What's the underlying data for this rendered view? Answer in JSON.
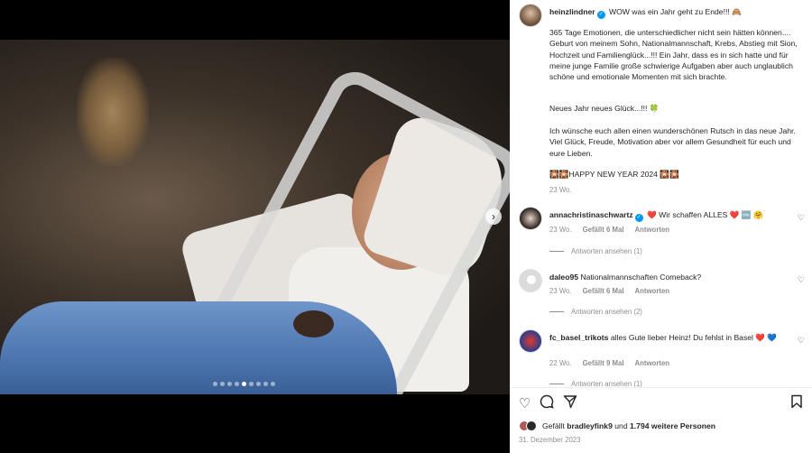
{
  "post": {
    "username": "heinzlindner",
    "headline": "WOW was ein Jahr geht zu Ende!!! 🙈",
    "paragraphs": [
      "365 Tage Emotionen, die unterschiedlicher nicht sein hätten können.... Geburt von meinem Sohn, Nationalmannschaft, Krebs, Abstieg mit Sion, Hochzeit und Familienglück...!!! Ein Jahr, dass es in sich hatte und für meine junge Familie große schwierige Aufgaben aber auch unglaublich schöne und emotionale Momenten mit sich brachte.",
      "Neues Jahr neues Glück...!!! 🍀",
      "Ich wünsche euch allen einen wunderschönen Rutsch in das neue Jahr. Viel Glück, Freude, Motivation aber vor allem Gesundheit für euch und eure Lieben.",
      "🎇🎇HAPPY NEW YEAR 2024 🎇🎇"
    ],
    "age": "23 Wo."
  },
  "comments": [
    {
      "username": "annachristinaschwartz",
      "text": "❤️ Wir schaffen ALLES ❤️ 🆒 🤗",
      "age": "23 Wo.",
      "likes": "Gefällt 6 Mal",
      "reply": "Antworten",
      "view_replies": "Antworten ansehen (1)"
    },
    {
      "username": "daleo95",
      "text": "Nationalmannschaften Comeback?",
      "age": "23 Wo.",
      "likes": "Gefällt 6 Mal",
      "reply": "Antworten",
      "view_replies": "Antworten ansehen (2)"
    },
    {
      "username": "fc_basel_trikots",
      "text": "alles Gute lieber Heinz! Du fehlst in Basel ❤️ 💙",
      "age": "22 Wo.",
      "likes": "Gefällt 9 Mal",
      "reply": "Antworten",
      "view_replies": "Antworten ansehen (1)"
    }
  ],
  "likes_summary": {
    "prefix": "Gefällt",
    "user": "bradleyfink9",
    "middle": "und",
    "others": "1.794 weitere Personen"
  },
  "date": "31. Dezember 2023",
  "icons": {
    "heart": "heart-icon",
    "comment": "comment-icon",
    "share": "share-icon",
    "bookmark": "bookmark-icon",
    "next": "chevron-right-icon"
  },
  "carousel": {
    "count": 9,
    "active_index": 4
  },
  "colors": {
    "verified": "#0095f6",
    "muted": "#8e8e8e",
    "text": "#262626"
  }
}
